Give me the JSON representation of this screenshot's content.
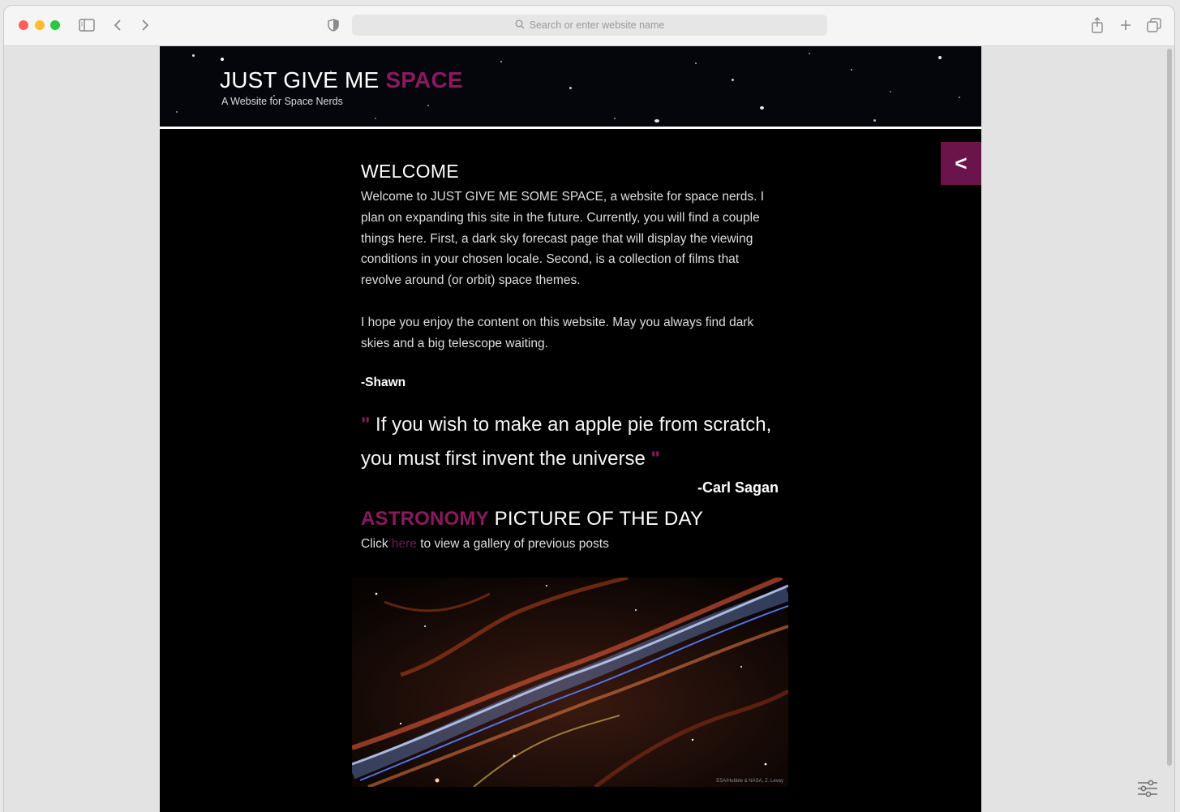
{
  "browser": {
    "url_placeholder": "Search or enter website name",
    "icons": [
      "sidebar-icon",
      "back-icon",
      "forward-icon",
      "shield-icon",
      "search-icon",
      "share-icon",
      "new-tab-icon",
      "tabs-overview-icon",
      "settings-sliders-icon"
    ]
  },
  "header": {
    "title_main": "JUST GIVE ME ",
    "title_accent": "SPACE",
    "subtitle": "A Website for Space Nerds",
    "menu_toggle": "<"
  },
  "welcome": {
    "heading": "WELCOME",
    "paragraph1": "Welcome to JUST GIVE ME SOME SPACE, a website for space nerds. I plan on expanding this site in the future. Currently, you will find a couple things here. First, a dark sky forecast page that will display the viewing conditions in your chosen locale. Second, is a collection of films that revolve around (or orbit) space themes.",
    "paragraph2": "I hope you enjoy the content on this website.  May you always find dark skies and a big telescope waiting.",
    "signature": "-Shawn"
  },
  "quote": {
    "open_mark": "\"",
    "text": " If you wish to make an apple pie from scratch, you must first invent the universe ",
    "close_mark": "\"",
    "author": "-Carl Sagan"
  },
  "apod": {
    "title_accent": "ASTRONOMY",
    "title_rest": " PICTURE OF THE DAY",
    "prefix": "Click ",
    "link": "here",
    "suffix": " to view a gallery of previous posts",
    "image_credit": "ESA/Hubble & NASA, Z. Levay"
  },
  "colors": {
    "accent": "#8a1a5e",
    "menu_button": "#6b134b"
  }
}
